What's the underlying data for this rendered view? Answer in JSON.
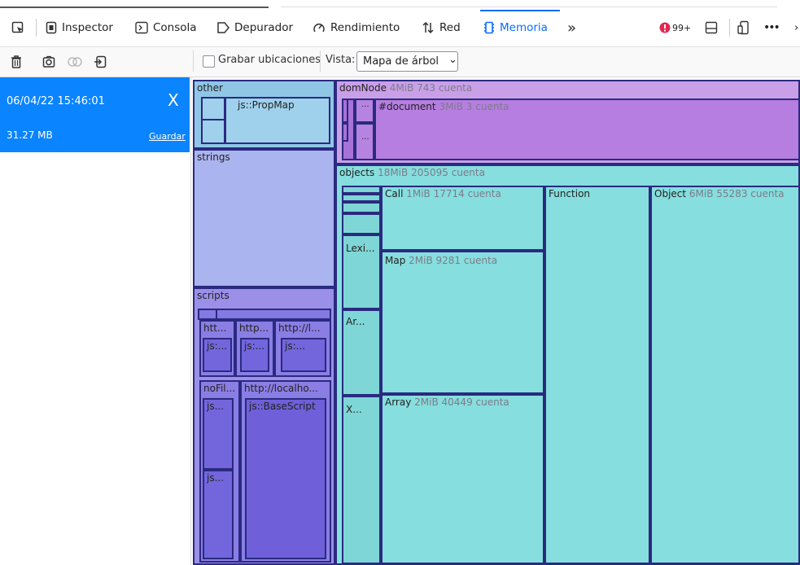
{
  "tabs": [
    {
      "label": "Inspector"
    },
    {
      "label": "Consola"
    },
    {
      "label": "Depurador"
    },
    {
      "label": "Rendimiento"
    },
    {
      "label": "Red"
    },
    {
      "label": "Memoria"
    }
  ],
  "toolbar": {
    "more_tabs": "»",
    "error_count": "99+",
    "overflow": "•••",
    "record_label": "Grabar ubicaciones",
    "view_label": "Vista:",
    "view_value": "Mapa de árbol",
    "view_chevron": "⌄"
  },
  "icons": {
    "pick": "pick-element-icon",
    "inspector": "inspector-icon",
    "console": "console-icon",
    "debugger": "debugger-icon",
    "performance": "performance-icon",
    "network": "network-icon",
    "memory": "memory-icon",
    "error": "error-icon",
    "dock": "dock-icon",
    "responsive": "responsive-icon",
    "trash": "trash-icon",
    "snapshot": "camera-icon",
    "diff": "diff-icon",
    "import": "import-icon"
  },
  "snapshot": {
    "date": "06/04/22 15:46:01",
    "close": "X",
    "size": "31.27 MB",
    "save": "Guardar"
  },
  "treemap": {
    "other": {
      "label": "other",
      "child": "js::PropMap"
    },
    "strings": {
      "label": "strings"
    },
    "scripts": {
      "label": "scripts",
      "c1": "htt...",
      "c1a": "js:...",
      "c2": "http...",
      "c2a": "js:...",
      "c3": "http://l...",
      "c3a": "js:...",
      "c4": "noFil...",
      "c4a": "js...",
      "c4b": "js...",
      "c5": "http://localho...",
      "c5a": "js::BaseScript"
    },
    "domNode": {
      "label": "domNode",
      "stats": "4MiB 743 cuenta",
      "c1": "...",
      "c2": "...",
      "document": "#document",
      "document_stats": "3MiB 3 cuenta"
    },
    "objects": {
      "label": "objects",
      "stats": "18MiB 205095 cuenta",
      "lexi": "Lexi...",
      "ar": "Ar...",
      "x": "X...",
      "call": "Call",
      "call_stats": "1MiB 17714 cuenta",
      "map": "Map",
      "map_stats": "2MiB 9281 cuenta",
      "array": "Array",
      "array_stats": "2MiB 40449 cuenta",
      "function": "Function",
      "object": "Object",
      "object_stats": "6MiB 55283 cuenta"
    }
  },
  "colors": {
    "accent": "#0a84ff",
    "other": "#8fc6e6",
    "strings": "#aab4ee",
    "scripts": "#7a6be0",
    "domNode": "#c9a0e8",
    "document": "#b67ee0",
    "objects": "#86dede"
  }
}
